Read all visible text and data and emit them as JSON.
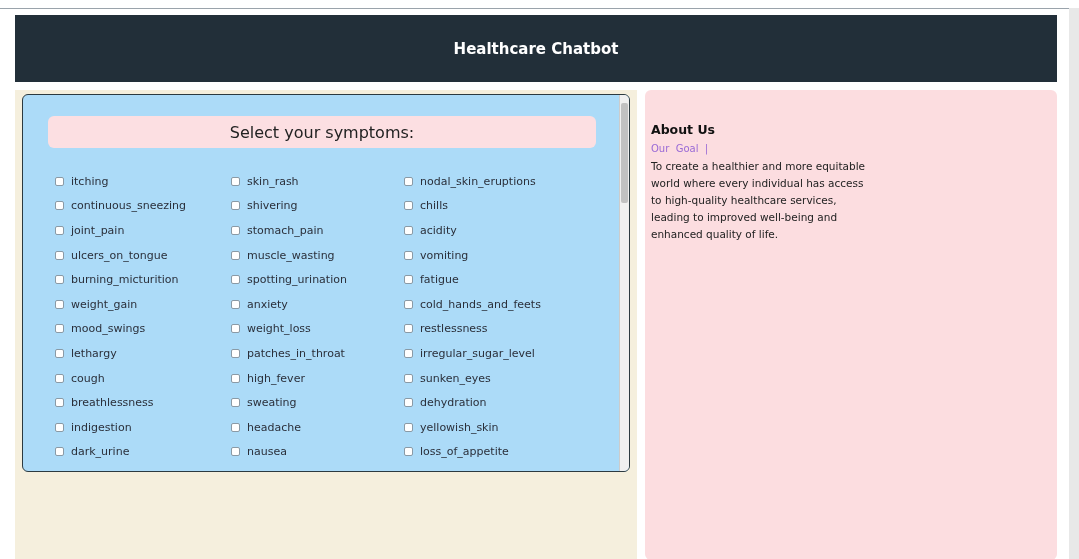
{
  "header": {
    "title": "Healthcare Chatbot"
  },
  "symptoms": {
    "heading": "Select your symptoms:",
    "items": [
      {
        "label": "itching",
        "checked": false
      },
      {
        "label": "skin_rash",
        "checked": false
      },
      {
        "label": "nodal_skin_eruptions",
        "checked": false
      },
      {
        "label": "continuous_sneezing",
        "checked": false
      },
      {
        "label": "shivering",
        "checked": false
      },
      {
        "label": "chills",
        "checked": false
      },
      {
        "label": "joint_pain",
        "checked": false
      },
      {
        "label": "stomach_pain",
        "checked": false
      },
      {
        "label": "acidity",
        "checked": false
      },
      {
        "label": "ulcers_on_tongue",
        "checked": false
      },
      {
        "label": "muscle_wasting",
        "checked": false
      },
      {
        "label": "vomiting",
        "checked": false
      },
      {
        "label": "burning_micturition",
        "checked": false
      },
      {
        "label": "spotting_urination",
        "checked": false
      },
      {
        "label": "fatigue",
        "checked": false
      },
      {
        "label": "weight_gain",
        "checked": false
      },
      {
        "label": "anxiety",
        "checked": false
      },
      {
        "label": "cold_hands_and_feets",
        "checked": false
      },
      {
        "label": "mood_swings",
        "checked": false
      },
      {
        "label": "weight_loss",
        "checked": false
      },
      {
        "label": "restlessness",
        "checked": false
      },
      {
        "label": "lethargy",
        "checked": false
      },
      {
        "label": "patches_in_throat",
        "checked": false
      },
      {
        "label": "irregular_sugar_level",
        "checked": false
      },
      {
        "label": "cough",
        "checked": false
      },
      {
        "label": "high_fever",
        "checked": false
      },
      {
        "label": "sunken_eyes",
        "checked": false
      },
      {
        "label": "breathlessness",
        "checked": false
      },
      {
        "label": "sweating",
        "checked": false
      },
      {
        "label": "dehydration",
        "checked": false
      },
      {
        "label": "indigestion",
        "checked": false
      },
      {
        "label": "headache",
        "checked": false
      },
      {
        "label": "yellowish_skin",
        "checked": false
      },
      {
        "label": "dark_urine",
        "checked": false
      },
      {
        "label": "nausea",
        "checked": false
      },
      {
        "label": "loss_of_appetite",
        "checked": false
      }
    ]
  },
  "about": {
    "title": "About Us",
    "subtitle": "Our  Goal  |",
    "text": "To create a healthier and more equitable world where every individual has access to high-quality healthcare services, leading to improved well-being and enhanced quality of life."
  }
}
